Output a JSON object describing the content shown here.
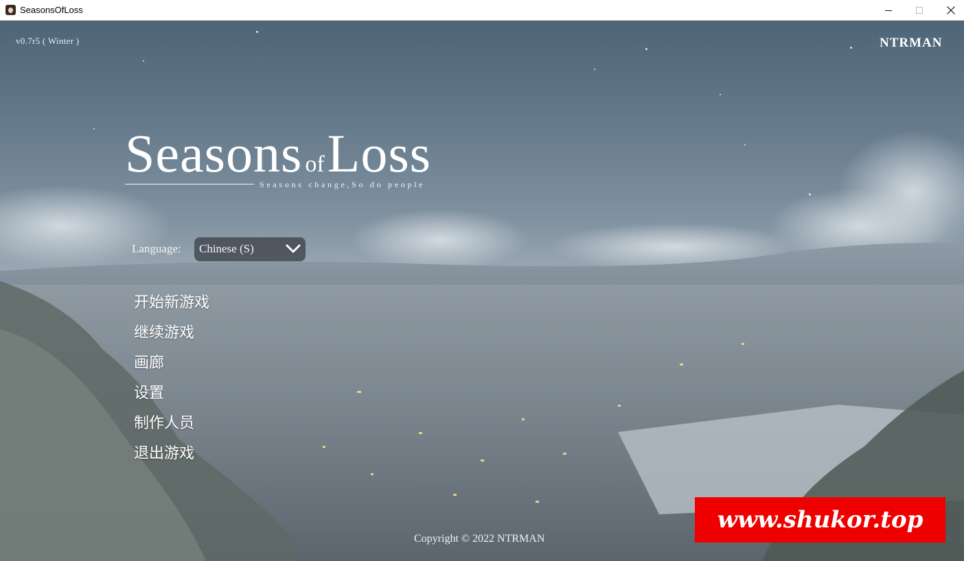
{
  "window": {
    "title": "SeasonsOfLoss"
  },
  "header": {
    "version": "v0.7r5 ( Winter )",
    "brand": "NTRMAN"
  },
  "game_title": {
    "main_1": "Seasons",
    "connector": "of",
    "main_2": "Loss",
    "subtitle": "Seasons change,So do people"
  },
  "language": {
    "label": "Language:",
    "selected": "Chinese (S)"
  },
  "menu": {
    "items": [
      {
        "label": "开始新游戏"
      },
      {
        "label": "继续游戏"
      },
      {
        "label": "画廊"
      },
      {
        "label": "设置"
      },
      {
        "label": "制作人员"
      },
      {
        "label": "退出游戏"
      }
    ]
  },
  "footer": {
    "copyright": "Copyright © 2022 NTRMAN"
  },
  "watermark": {
    "text": "www.shukor.top",
    "color": "#ee0000"
  },
  "icons": {
    "app": "app-icon",
    "minimize": "minimize-icon",
    "maximize": "maximize-icon",
    "close": "close-icon",
    "dropdown": "chevron-down-icon"
  }
}
